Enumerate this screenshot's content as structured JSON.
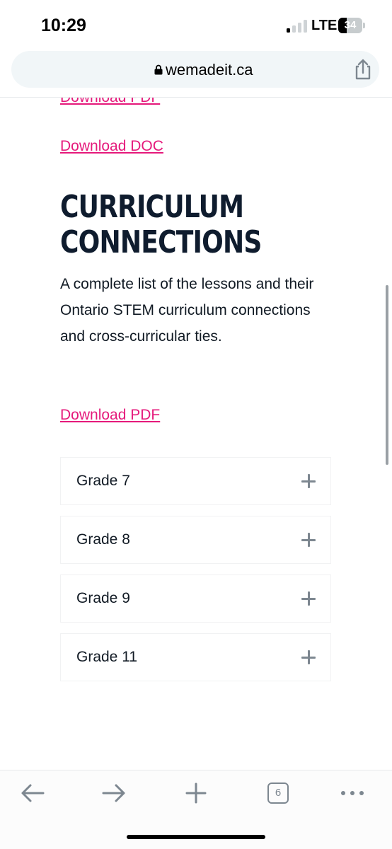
{
  "status_bar": {
    "time": "10:29",
    "network": "LTE",
    "battery_percent": "34",
    "battery_level": 0.34,
    "signal_bars_active": 1,
    "signal_bars_total": 4
  },
  "browser": {
    "url": "wemadeit.ca",
    "lock_icon": "lock-icon",
    "share_icon": "share-icon"
  },
  "content": {
    "cut_off_link": "Download PDF",
    "download_doc": "Download DOC",
    "heading": "CURRICULUM CONNECTIONS",
    "description": "A complete list of the lessons and their Ontario STEM curriculum connections and cross-curricular ties.",
    "download_pdf": "Download PDF",
    "accordion": [
      {
        "label": "Grade 7"
      },
      {
        "label": "Grade 8"
      },
      {
        "label": "Grade 9"
      },
      {
        "label": "Grade 11"
      }
    ],
    "accordion_icon": "plus-icon"
  },
  "toolbar": {
    "back_icon": "arrow-left-icon",
    "forward_icon": "arrow-right-icon",
    "new_tab_icon": "plus-icon",
    "tab_count": "6",
    "more_icon": "ellipsis-icon"
  },
  "colors": {
    "link": "#e5197b",
    "heading": "#0f1c2e",
    "icon_gray": "#7d8790",
    "address_bar_bg": "#f1f6f8"
  }
}
